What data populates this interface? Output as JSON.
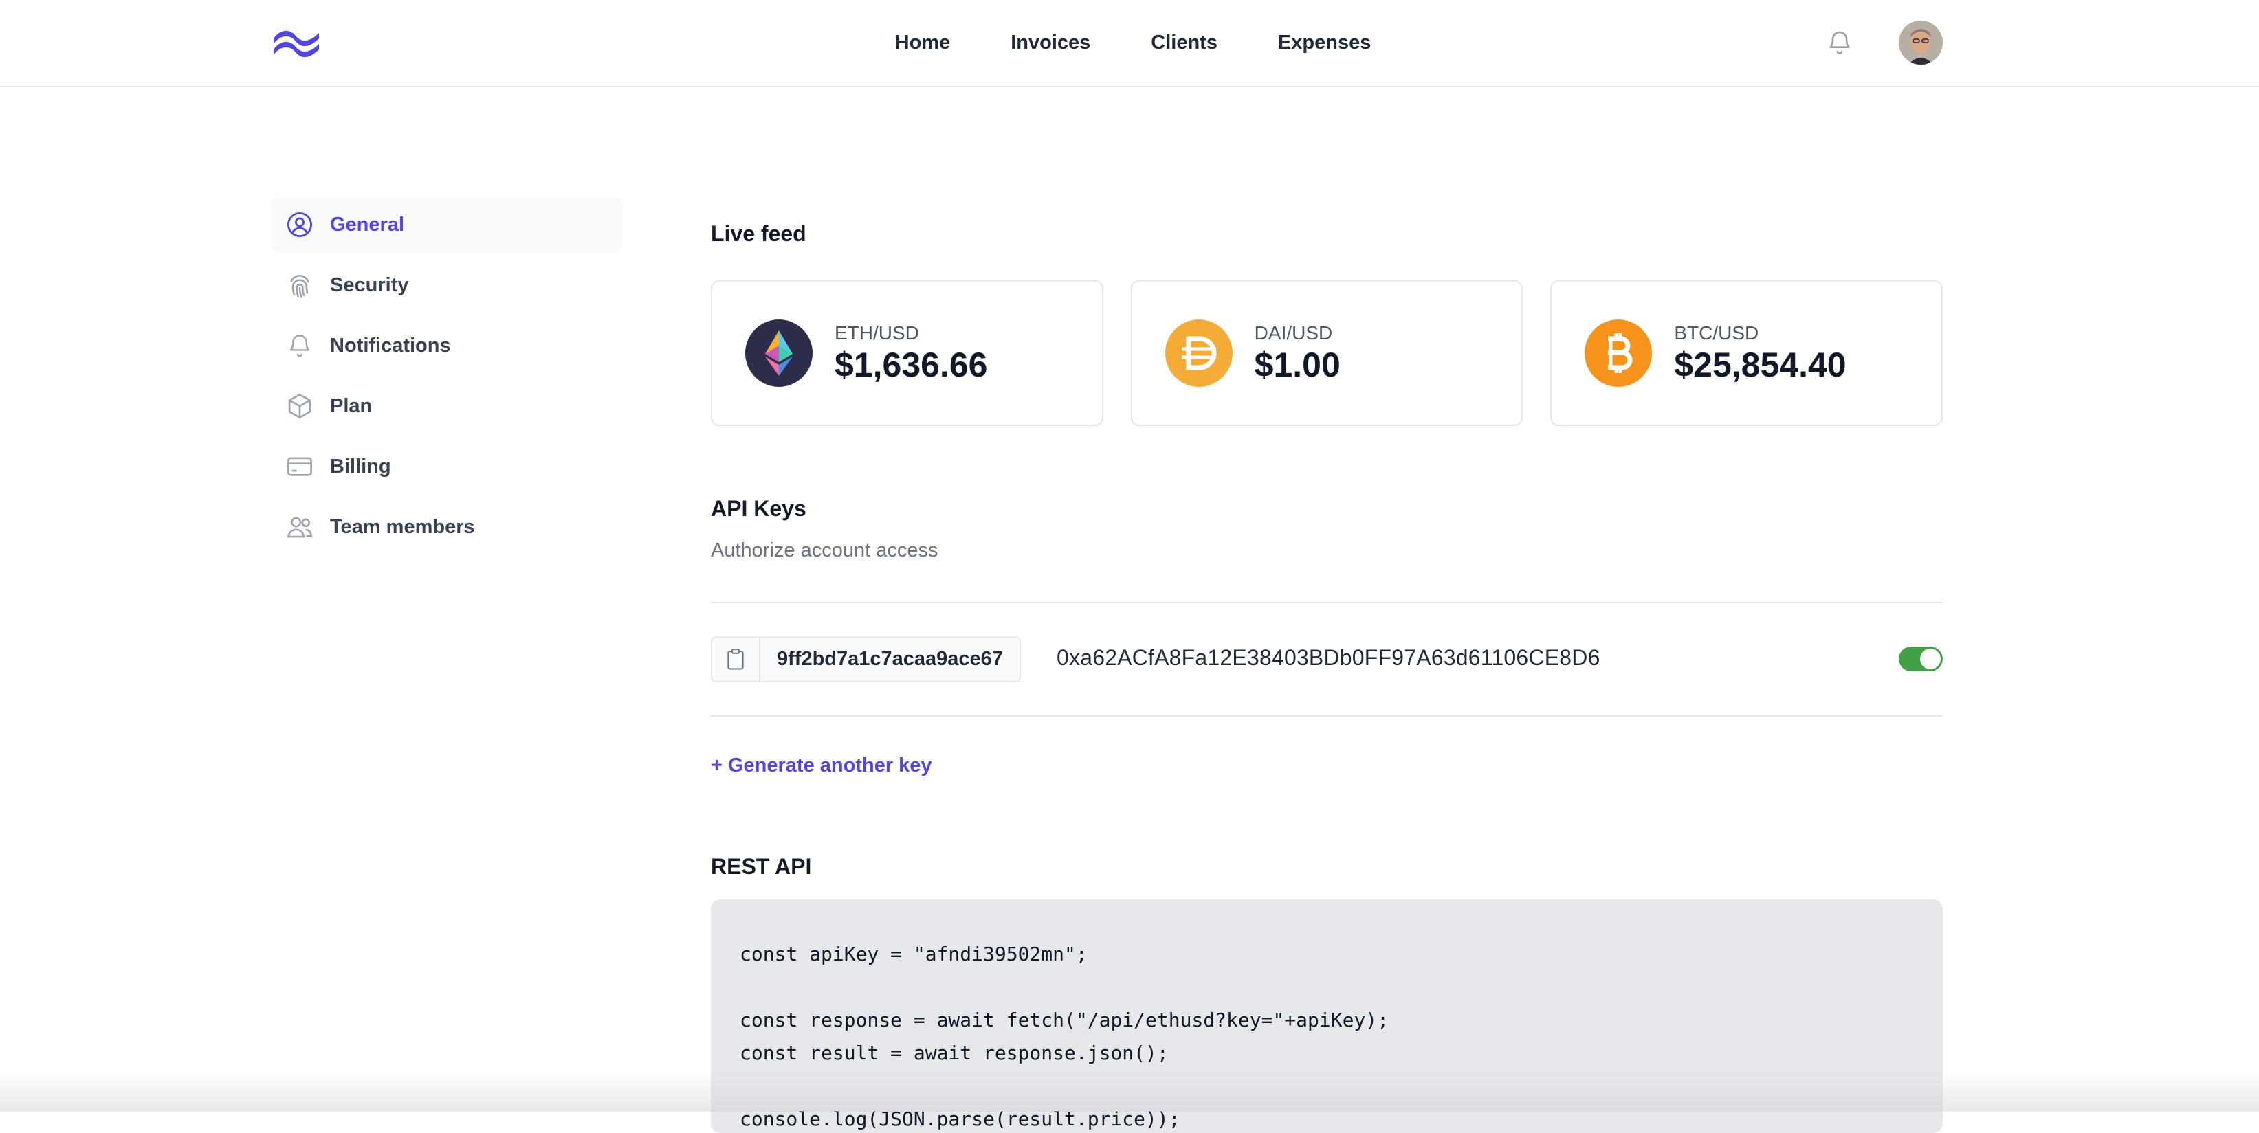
{
  "nav": {
    "links": [
      "Home",
      "Invoices",
      "Clients",
      "Expenses"
    ],
    "logo_icon": "wave-logo-icon",
    "notification_icon": "bell-icon",
    "accent": "#4f46e5"
  },
  "sidebar": {
    "items": [
      {
        "label": "General",
        "icon": "user-circle-icon",
        "active": true
      },
      {
        "label": "Security",
        "icon": "fingerprint-icon",
        "active": false
      },
      {
        "label": "Notifications",
        "icon": "bell-icon",
        "active": false
      },
      {
        "label": "Plan",
        "icon": "cube-icon",
        "active": false
      },
      {
        "label": "Billing",
        "icon": "credit-card-icon",
        "active": false
      },
      {
        "label": "Team members",
        "icon": "users-icon",
        "active": false
      }
    ]
  },
  "live_feed": {
    "title": "Live feed",
    "cards": [
      {
        "pair": "ETH/USD",
        "price": "$1,636.66",
        "icon": "ethereum-icon"
      },
      {
        "pair": "DAI/USD",
        "price": "$1.00",
        "icon": "dai-icon"
      },
      {
        "pair": "BTC/USD",
        "price": "$25,854.40",
        "icon": "bitcoin-icon"
      }
    ]
  },
  "api_keys": {
    "title": "API Keys",
    "subtitle": "Authorize account access",
    "key": "9ff2bd7a1c7acaa9ace67",
    "address": "0xa62ACfA8Fa12E38403BDb0FF97A63d61106CE8D6",
    "enabled": true,
    "generate_label": "+ Generate another key"
  },
  "rest_api": {
    "title": "REST API",
    "code_lines": [
      "const apiKey = \"afndi39502mn\";",
      "",
      "const response = await fetch(\"/api/ethusd?key=\"+apiKey);",
      "const result = await response.json();",
      "",
      "console.log(JSON.parse(result.price));"
    ]
  },
  "colors": {
    "toggle_on": "#43a047",
    "code_bg": "#e5e7eb"
  }
}
